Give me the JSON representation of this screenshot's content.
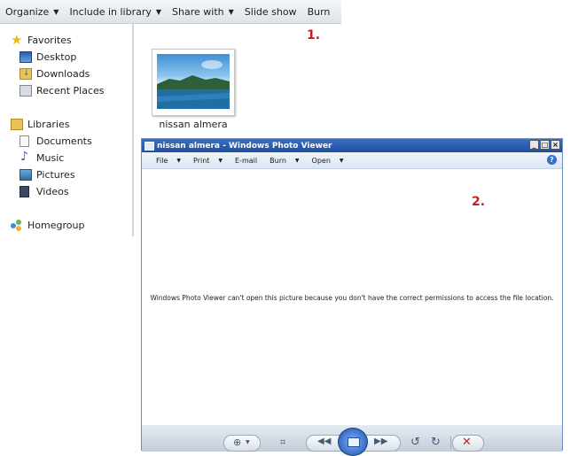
{
  "toolbar": {
    "items": [
      {
        "label": "Organize",
        "has_arrow": true
      },
      {
        "label": "Include in library",
        "has_arrow": true
      },
      {
        "label": "Share with",
        "has_arrow": true
      },
      {
        "label": "Slide show",
        "has_arrow": false
      },
      {
        "label": "Burn",
        "has_arrow": false
      }
    ]
  },
  "annotations": {
    "first": "1.",
    "second": "2."
  },
  "nav": {
    "favorites": "Favorites",
    "desktop": "Desktop",
    "downloads": "Downloads",
    "recent_places": "Recent Places",
    "libraries": "Libraries",
    "documents": "Documents",
    "music": "Music",
    "pictures": "Pictures",
    "videos": "Videos",
    "homegroup": "Homegroup"
  },
  "file": {
    "name": "nissan almera"
  },
  "viewer": {
    "title": "nissan almera - Windows Photo Viewer",
    "menus": [
      "File",
      "Print",
      "E-mail",
      "Burn",
      "Open"
    ],
    "message": "Windows Photo Viewer can't open this picture because you don't have the correct permissions to access the file location."
  },
  "colors": {
    "annotation": "#d11a1a",
    "titlebar": "#1d4ea3",
    "accent": "#2f6fd0"
  }
}
